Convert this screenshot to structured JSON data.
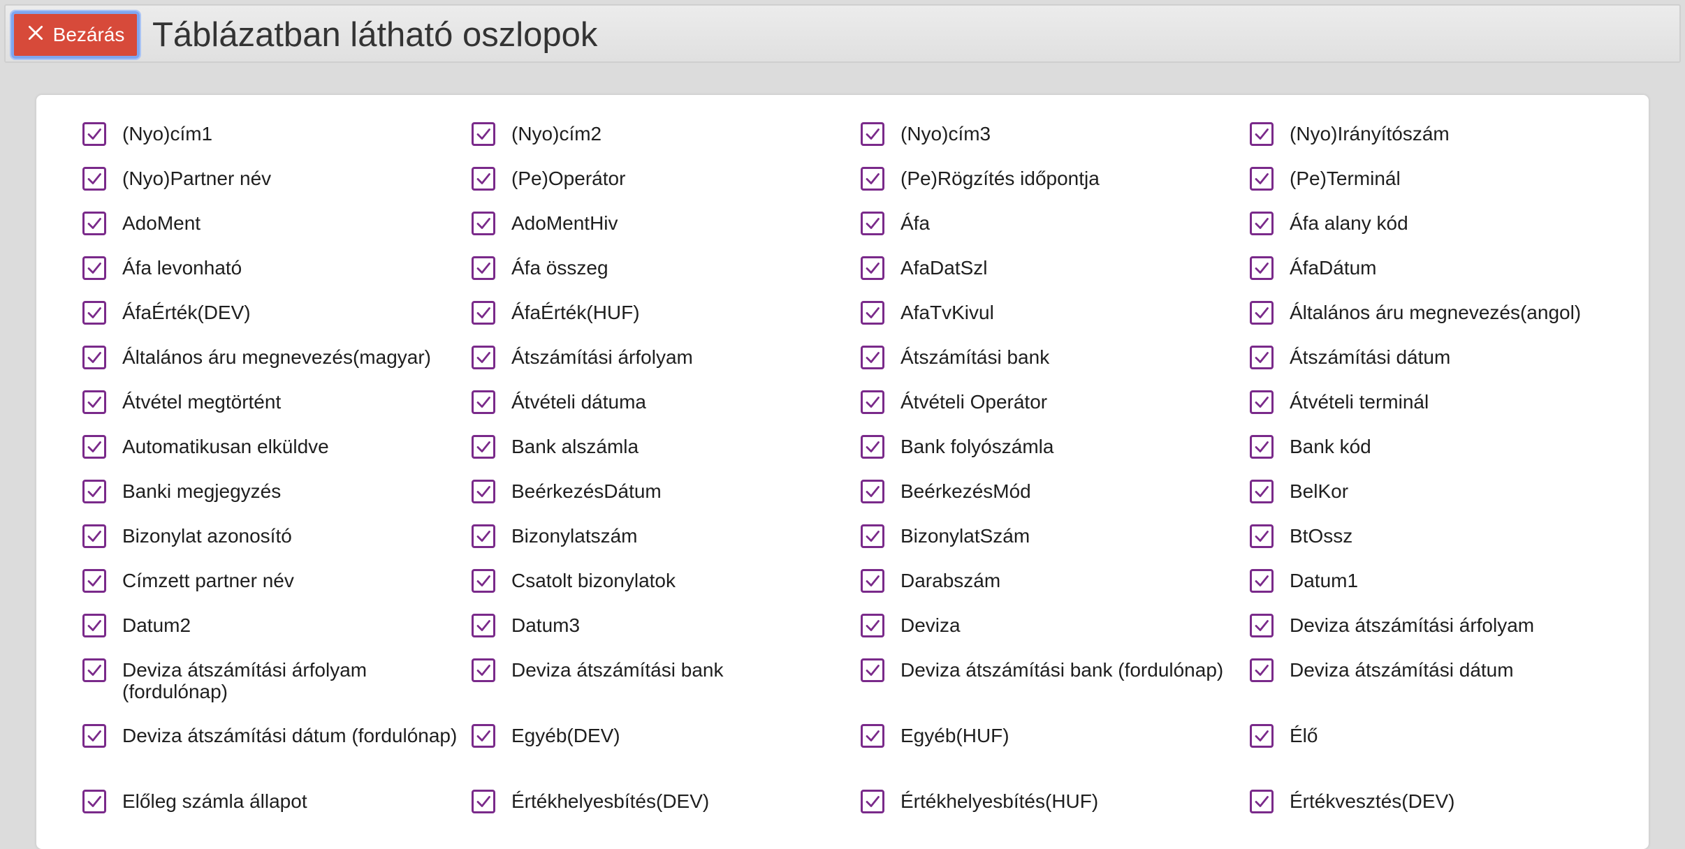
{
  "header": {
    "close_label": "Bezárás",
    "title": "Táblázatban látható oszlopok"
  },
  "colors": {
    "close_button": "#d74a3a",
    "checkbox_accent": "#7a2a8a",
    "background": "#dcdcdc"
  },
  "columns": [
    {
      "label": "(Nyo)cím1",
      "checked": true
    },
    {
      "label": "(Nyo)cím2",
      "checked": true
    },
    {
      "label": "(Nyo)cím3",
      "checked": true
    },
    {
      "label": "(Nyo)Irányítószám",
      "checked": true
    },
    {
      "label": "(Nyo)Partner név",
      "checked": true
    },
    {
      "label": "(Pe)Operátor",
      "checked": true
    },
    {
      "label": "(Pe)Rögzítés időpontja",
      "checked": true
    },
    {
      "label": "(Pe)Terminál",
      "checked": true
    },
    {
      "label": "AdoMent",
      "checked": true
    },
    {
      "label": "AdoMentHiv",
      "checked": true
    },
    {
      "label": "Áfa",
      "checked": true
    },
    {
      "label": "Áfa alany kód",
      "checked": true
    },
    {
      "label": "Áfa levonható",
      "checked": true
    },
    {
      "label": "Áfa összeg",
      "checked": true
    },
    {
      "label": "AfaDatSzl",
      "checked": true
    },
    {
      "label": "ÁfaDátum",
      "checked": true
    },
    {
      "label": "ÁfaÉrték(DEV)",
      "checked": true
    },
    {
      "label": "ÁfaÉrték(HUF)",
      "checked": true
    },
    {
      "label": "AfaTvKivul",
      "checked": true
    },
    {
      "label": "Általános áru megnevezés(angol)",
      "checked": true
    },
    {
      "label": "Általános áru megnevezés(magyar)",
      "checked": true
    },
    {
      "label": "Átszámítási árfolyam",
      "checked": true
    },
    {
      "label": "Átszámítási bank",
      "checked": true
    },
    {
      "label": "Átszámítási dátum",
      "checked": true
    },
    {
      "label": "Átvétel megtörtént",
      "checked": true
    },
    {
      "label": "Átvételi dátuma",
      "checked": true
    },
    {
      "label": "Átvételi Operátor",
      "checked": true
    },
    {
      "label": "Átvételi terminál",
      "checked": true
    },
    {
      "label": "Automatikusan elküldve",
      "checked": true
    },
    {
      "label": "Bank alszámla",
      "checked": true
    },
    {
      "label": "Bank folyószámla",
      "checked": true
    },
    {
      "label": "Bank kód",
      "checked": true
    },
    {
      "label": "Banki megjegyzés",
      "checked": true
    },
    {
      "label": "BeérkezésDátum",
      "checked": true
    },
    {
      "label": "BeérkezésMód",
      "checked": true
    },
    {
      "label": "BelKor",
      "checked": true
    },
    {
      "label": "Bizonylat azonosító",
      "checked": true
    },
    {
      "label": "Bizonylatszám",
      "checked": true
    },
    {
      "label": "BizonylatSzám",
      "checked": true
    },
    {
      "label": "BtOssz",
      "checked": true
    },
    {
      "label": "Címzett partner név",
      "checked": true
    },
    {
      "label": "Csatolt bizonylatok",
      "checked": true
    },
    {
      "label": "Darabszám",
      "checked": true
    },
    {
      "label": "Datum1",
      "checked": true
    },
    {
      "label": "Datum2",
      "checked": true
    },
    {
      "label": "Datum3",
      "checked": true
    },
    {
      "label": "Deviza",
      "checked": true
    },
    {
      "label": "Deviza átszámítási árfolyam",
      "checked": true
    },
    {
      "label": "Deviza átszámítási árfolyam (fordulónap)",
      "checked": true
    },
    {
      "label": "Deviza átszámítási bank",
      "checked": true
    },
    {
      "label": "Deviza átszámítási bank (fordulónap)",
      "checked": true
    },
    {
      "label": "Deviza átszámítási dátum",
      "checked": true
    },
    {
      "label": "Deviza átszámítási dátum (fordulónap)",
      "checked": true
    },
    {
      "label": "Egyéb(DEV)",
      "checked": true
    },
    {
      "label": "Egyéb(HUF)",
      "checked": true
    },
    {
      "label": "Élő",
      "checked": true
    },
    {
      "label": "Előleg számla állapot",
      "checked": true
    },
    {
      "label": "Értékhelyesbítés(DEV)",
      "checked": true
    },
    {
      "label": "Értékhelyesbítés(HUF)",
      "checked": true
    },
    {
      "label": "Értékvesztés(DEV)",
      "checked": true
    }
  ]
}
